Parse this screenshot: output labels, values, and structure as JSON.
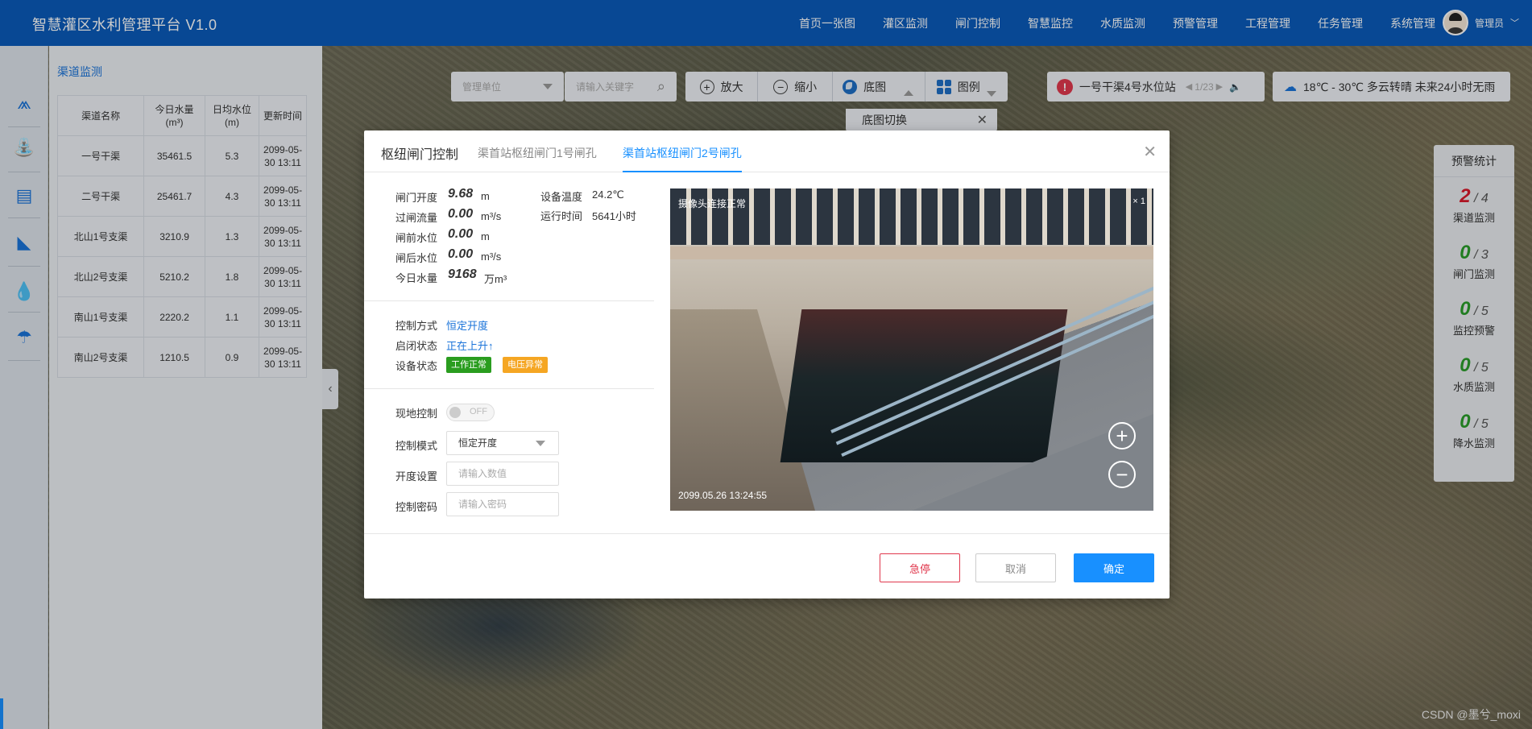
{
  "header": {
    "title": "智慧灌区水利管理平台 V1.0",
    "nav": [
      "首页一张图",
      "灌区监测",
      "闸门控制",
      "智慧监控",
      "水质监测",
      "预警管理",
      "工程管理",
      "任务管理",
      "系统管理"
    ],
    "user": "管理员"
  },
  "rail": {
    "icons": [
      "canal-icon",
      "water-level-icon",
      "gate-icon",
      "camera-icon",
      "water-quality-icon",
      "rain-icon"
    ]
  },
  "panel": {
    "title": "渠道监测",
    "columns": [
      "渠道名称",
      "今日水量(m³)",
      "日均水位(m)",
      "更新时间"
    ],
    "rows": [
      [
        "一号干渠",
        "35461.5",
        "5.3",
        "2099-05-30 13:11"
      ],
      [
        "二号干渠",
        "25461.7",
        "4.3",
        "2099-05-30 13:11"
      ],
      [
        "北山1号支渠",
        "3210.9",
        "1.3",
        "2099-05-30 13:11"
      ],
      [
        "北山2号支渠",
        "5210.2",
        "1.8",
        "2099-05-30 13:11"
      ],
      [
        "南山1号支渠",
        "2220.2",
        "1.1",
        "2099-05-30 13:11"
      ],
      [
        "南山2号支渠",
        "1210.5",
        "0.9",
        "2099-05-30 13:11"
      ]
    ]
  },
  "toolbar": {
    "unit_placeholder": "管理单位",
    "search_placeholder": "请输入关键字",
    "zoom_in": "放大",
    "zoom_out": "缩小",
    "basemap": "底图",
    "legend": "图例",
    "alert_station": "一号干渠4号水位站",
    "alert_page": "1/23",
    "weather": "18℃ - 30℃ 多云转晴 未来24小时无雨",
    "basemap_menu": "底图切换"
  },
  "warning": {
    "title": "预警统计",
    "items": [
      {
        "num": "2",
        "total": "4",
        "label": "渠道监测",
        "color": "#d9192b"
      },
      {
        "num": "0",
        "total": "3",
        "label": "闸门监测",
        "color": "#2a9d2a"
      },
      {
        "num": "0",
        "total": "5",
        "label": "监控预警",
        "color": "#2a9d2a"
      },
      {
        "num": "0",
        "total": "5",
        "label": "水质监测",
        "color": "#2a9d2a"
      },
      {
        "num": "0",
        "total": "5",
        "label": "降水监测",
        "color": "#2a9d2a"
      }
    ]
  },
  "modal": {
    "title": "枢纽闸门控制",
    "tabs": [
      "渠首站枢纽闸门1号闸孔",
      "渠首站枢纽闸门2号闸孔"
    ],
    "active_tab": 1,
    "gate_open": {
      "label": "闸门开度",
      "value": "9.68",
      "unit": "m"
    },
    "flow": {
      "label": "过闸流量",
      "value": "0.00",
      "unit": "m³/s"
    },
    "front_level": {
      "label": "闸前水位",
      "value": "0.00",
      "unit": "m"
    },
    "back_level": {
      "label": "闸后水位",
      "value": "0.00",
      "unit": "m³/s"
    },
    "today_water": {
      "label": "今日水量",
      "value": "9168",
      "unit": "万m³"
    },
    "temp": {
      "label": "设备温度",
      "value": "24.2℃"
    },
    "runtime": {
      "label": "运行时间",
      "value": "5641小时"
    },
    "control_mode": {
      "label": "控制方式",
      "value": "恒定开度"
    },
    "open_status": {
      "label": "启闭状态",
      "value": "正在上升↑"
    },
    "device_status": {
      "label": "设备状态",
      "badges": [
        "工作正常",
        "电压异常"
      ]
    },
    "local_control": {
      "label": "现地控制",
      "toggle": "OFF"
    },
    "mode": {
      "label": "控制模式",
      "value": "恒定开度"
    },
    "opening": {
      "label": "开度设置",
      "placeholder": "请输入数值"
    },
    "password": {
      "label": "控制密码",
      "placeholder": "请输入密码"
    },
    "camera": {
      "status": "摄像头连接正常",
      "scale": "× 1",
      "time": "2099.05.26 13:24:55"
    },
    "buttons": {
      "stop": "急停",
      "cancel": "取消",
      "ok": "确定"
    }
  },
  "watermark": "CSDN @墨兮_moxi",
  "colors": {
    "header": "#0b5bb9",
    "primary": "#1890ff",
    "danger": "#e0384d",
    "ok_badge": "#2a9d1f",
    "warn_badge": "#f5a623"
  }
}
